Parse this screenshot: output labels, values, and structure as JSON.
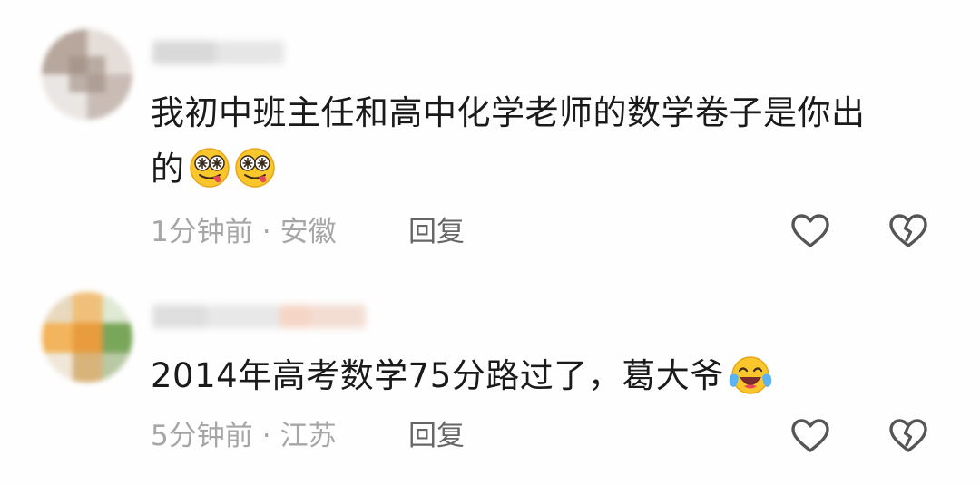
{
  "comments": [
    {
      "text_line1": "我初中班主任和高中化学老师的数学卷子是你出",
      "text_line2": "的",
      "emojis": [
        "drool-silly-emoji",
        "drool-silly-emoji"
      ],
      "time": "1分钟前",
      "separator": "·",
      "location": "安徽",
      "reply_label": "回复"
    },
    {
      "text_line1": "2014年高考数学75分路过了，葛大爷",
      "emojis": [
        "crying-laugh-emoji"
      ],
      "time": "5分钟前",
      "separator": "·",
      "location": "江苏",
      "reply_label": "回复"
    }
  ],
  "icons": {
    "like": "heart-outline-icon",
    "dislike": "broken-heart-icon"
  },
  "colors": {
    "text": "#1a1a1a",
    "meta": "#a6a6a6",
    "reply": "#666666",
    "icon": "#555555"
  }
}
